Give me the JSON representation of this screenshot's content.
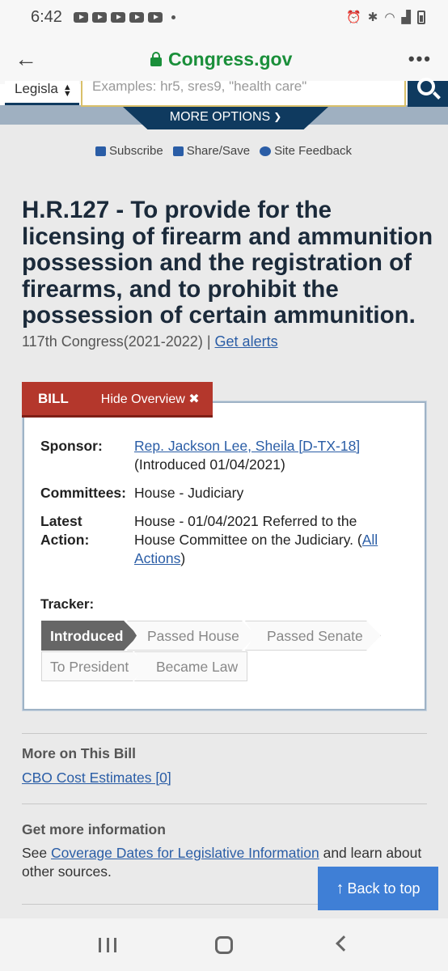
{
  "status_bar": {
    "time": "6:42",
    "notification_icons": [
      "youtube-icon",
      "youtube-icon",
      "youtube-icon",
      "youtube-icon",
      "youtube-icon",
      "dot-icon"
    ],
    "right_icons": [
      "alarm-icon",
      "bluetooth-icon",
      "wifi-icon",
      "signal-icon",
      "battery-icon"
    ]
  },
  "browser": {
    "url": "Congress.gov"
  },
  "search": {
    "select_value": "Legisla",
    "placeholder": "Examples: hr5, sres9, \"health care\"",
    "more_options": "MORE OPTIONS"
  },
  "share": {
    "subscribe": "Subscribe",
    "share_save": "Share/Save",
    "feedback": "Site Feedback"
  },
  "bill": {
    "title": "H.R.127 - To provide for the licensing of firearm and ammunition possession and the registration of firearms, and to prohibit the possession of certain ammunition.",
    "congress": "117th Congress(2021-2022)",
    "separator": "|",
    "get_alerts": "Get alerts"
  },
  "overview": {
    "tab_label": "BILL",
    "hide_label": "Hide Overview",
    "sponsor_label": "Sponsor:",
    "sponsor_link": "Rep. Jackson Lee, Sheila [D-TX-18]",
    "sponsor_intro": "(Introduced 01/04/2021)",
    "committees_label": "Committees:",
    "committees_value": "House - Judiciary",
    "latest_label_1": "Latest",
    "latest_label_2": "Action:",
    "latest_value": "House - 01/04/2021 Referred to the House Committee on the Judiciary.",
    "open_paren": "(",
    "all_actions_1": "All",
    "all_actions_2": "Actions",
    "close_paren": ")",
    "tracker_label": "Tracker:",
    "tracker_steps": [
      "Introduced",
      "Passed House",
      "Passed Senate",
      "To President",
      "Became Law"
    ],
    "tracker_active": "Introduced"
  },
  "more_on_bill": {
    "title": "More on This Bill",
    "cbo_link": "CBO Cost Estimates [0]"
  },
  "more_info": {
    "title": "Get more information",
    "text_before": "See",
    "link": "Coverage Dates for Legislative Information",
    "text_after": "and learn about other sources."
  },
  "back_to_top": "Back to top"
}
